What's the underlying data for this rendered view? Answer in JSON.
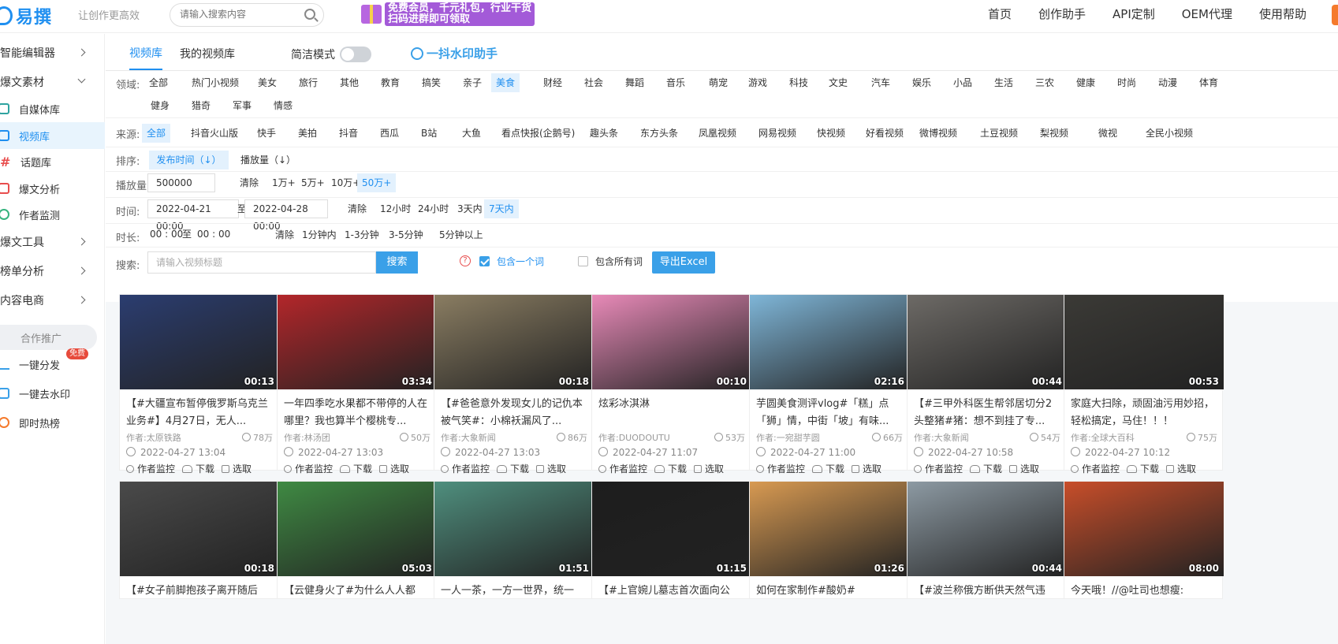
{
  "header": {
    "logo_text": "易撰",
    "slogan": "让创作更高效",
    "search_placeholder": "请输入搜索内容",
    "promo_line1": "免费会员，千元礼包，行业干货",
    "promo_line2": "扫码进群即可领取",
    "nav": [
      "首页",
      "创作助手",
      "API定制",
      "OEM代理",
      "使用帮助"
    ]
  },
  "sidebar": {
    "items": [
      {
        "label": "智能编辑器"
      },
      {
        "label": "爆文素材"
      },
      {
        "label": "自媒体库"
      },
      {
        "label": "视频库"
      },
      {
        "label": "话题库"
      },
      {
        "label": "爆文分析"
      },
      {
        "label": "作者监测"
      },
      {
        "label": "爆文工具"
      },
      {
        "label": "榜单分析"
      },
      {
        "label": "内容电商"
      }
    ],
    "promo_title": "合作推广",
    "promo_items": [
      "一键分发",
      "一键去水印",
      "即时热榜"
    ],
    "free_badge": "免费"
  },
  "tabs": {
    "library": "视频库",
    "mine": "我的视频库",
    "simple_mode": "简洁模式",
    "watermark_helper": "一抖水印助手"
  },
  "filters": {
    "domain_label": "领域:",
    "domains_row1": [
      "全部",
      "热门小视频",
      "美女",
      "旅行",
      "其他",
      "教育",
      "搞笑",
      "亲子",
      "美食",
      "财经",
      "社会",
      "舞蹈",
      "音乐",
      "萌宠",
      "游戏",
      "科技",
      "文史",
      "汽车",
      "娱乐",
      "小品",
      "生活",
      "三农",
      "健康",
      "时尚",
      "动漫",
      "体育"
    ],
    "domains_row2": [
      "健身",
      "猎奇",
      "军事",
      "情感"
    ],
    "domain_active": "美食",
    "source_label": "来源:",
    "sources": [
      "全部",
      "抖音火山版",
      "快手",
      "美拍",
      "抖音",
      "西瓜",
      "B站",
      "大鱼",
      "看点快报(企鹅号)",
      "趣头条",
      "东方头条",
      "凤凰视频",
      "网易视频",
      "快视频",
      "好看视频",
      "微博视频",
      "土豆视频",
      "梨视频",
      "微视",
      "全民小视频"
    ],
    "source_active": "全部",
    "sort_label": "排序:",
    "sort_time": "发布时间（↓）",
    "sort_plays": "播放量（↓）",
    "plays_label": "播放量:",
    "plays_value": "500000",
    "plays_opts": [
      "清除",
      "1万+",
      "5万+",
      "10万+",
      "50万+"
    ],
    "plays_active": "50万+",
    "time_label": "时间:",
    "time_from": "2022-04-21 00:00",
    "time_to_sep": "至",
    "time_to": "2022-04-28 00:00",
    "time_opts": [
      "清除",
      "12小时",
      "24小时",
      "3天内",
      "7天内"
    ],
    "time_active": "7天内",
    "duration_label": "时长:",
    "dur_from": "00 : 00",
    "dur_sep": "至",
    "dur_to": "00 : 00",
    "dur_opts": [
      "清除",
      "1分钟内",
      "1-3分钟",
      "3-5分钟",
      "5分钟以上"
    ],
    "search_label": "搜索:",
    "search_placeholder": "请输入视频标题",
    "search_btn": "搜索",
    "help": "?",
    "include_one": "包含一个词",
    "include_all": "包含所有词",
    "export_btn": "导出Excel"
  },
  "videos_row1": [
    {
      "duration": "00:13",
      "title": "【#大疆宣布暂停俄罗斯乌克兰业务#】4月27日，无人...",
      "author": "作者:太原铁路",
      "plays": "78万",
      "time": "2022-04-27 13:04",
      "bg": "#2b3d70"
    },
    {
      "duration": "03:34",
      "title": "一年四季吃水果都不带停的人在哪里？我也算半个樱桃专...",
      "author": "作者:林汤团",
      "plays": "50万",
      "time": "2022-04-27 13:03",
      "bg": "#b3262a"
    },
    {
      "duration": "00:18",
      "title": "【#爸爸意外发现女儿的记仇本被气笑#：小棉袄漏风了...",
      "author": "作者:大象新闻",
      "plays": "86万",
      "time": "2022-04-27 13:03",
      "bg": "#8a7d62"
    },
    {
      "duration": "00:10",
      "title": "炫彩冰淇淋",
      "author": "作者:DUODOUTU",
      "plays": "53万",
      "time": "2022-04-27 11:07",
      "bg": "#e88ab8"
    },
    {
      "duration": "02:16",
      "title": "芋圆美食测评vlog#「糕」点「狮」情，中街「坡」有味...",
      "author": "作者:一宛甜芋圆",
      "plays": "66万",
      "time": "2022-04-27 11:00",
      "bg": "#7fb6d8"
    },
    {
      "duration": "00:44",
      "title": "【#三甲外科医生帮邻居切分2头整猪#猪：想不到挂了专...",
      "author": "作者:大象新闻",
      "plays": "54万",
      "time": "2022-04-27 10:58",
      "bg": "#6d6a66"
    },
    {
      "duration": "00:53",
      "title": "家庭大扫除，顽固油污用妙招，轻松搞定，马住！！！",
      "author": "作者:全球大百科",
      "plays": "75万",
      "time": "2022-04-27 10:12",
      "bg": "#3b3a36"
    }
  ],
  "videos_row2": [
    {
      "duration": "00:18",
      "title": "【#女子前脚抱孩子离开随后",
      "bg": "#4a4a4a"
    },
    {
      "duration": "05:03",
      "title": "【云健身火了#为什么人人都",
      "bg": "#3f8a43"
    },
    {
      "duration": "01:51",
      "title": "一人一茶，一方一世界，统一",
      "bg": "#4f8f7e"
    },
    {
      "duration": "01:15",
      "title": "【#上官婉儿墓志首次面向公",
      "bg": "#1d1d1d"
    },
    {
      "duration": "01:26",
      "title": "如何在家制作#酸奶#",
      "bg": "#d89a52"
    },
    {
      "duration": "00:44",
      "title": "【#波兰称俄方断供天然气违",
      "bg": "#8d9aa3"
    },
    {
      "duration": "08:00",
      "title": "今天哦！//@吐司也想瘦:",
      "bg": "#c84e2a"
    }
  ]
}
